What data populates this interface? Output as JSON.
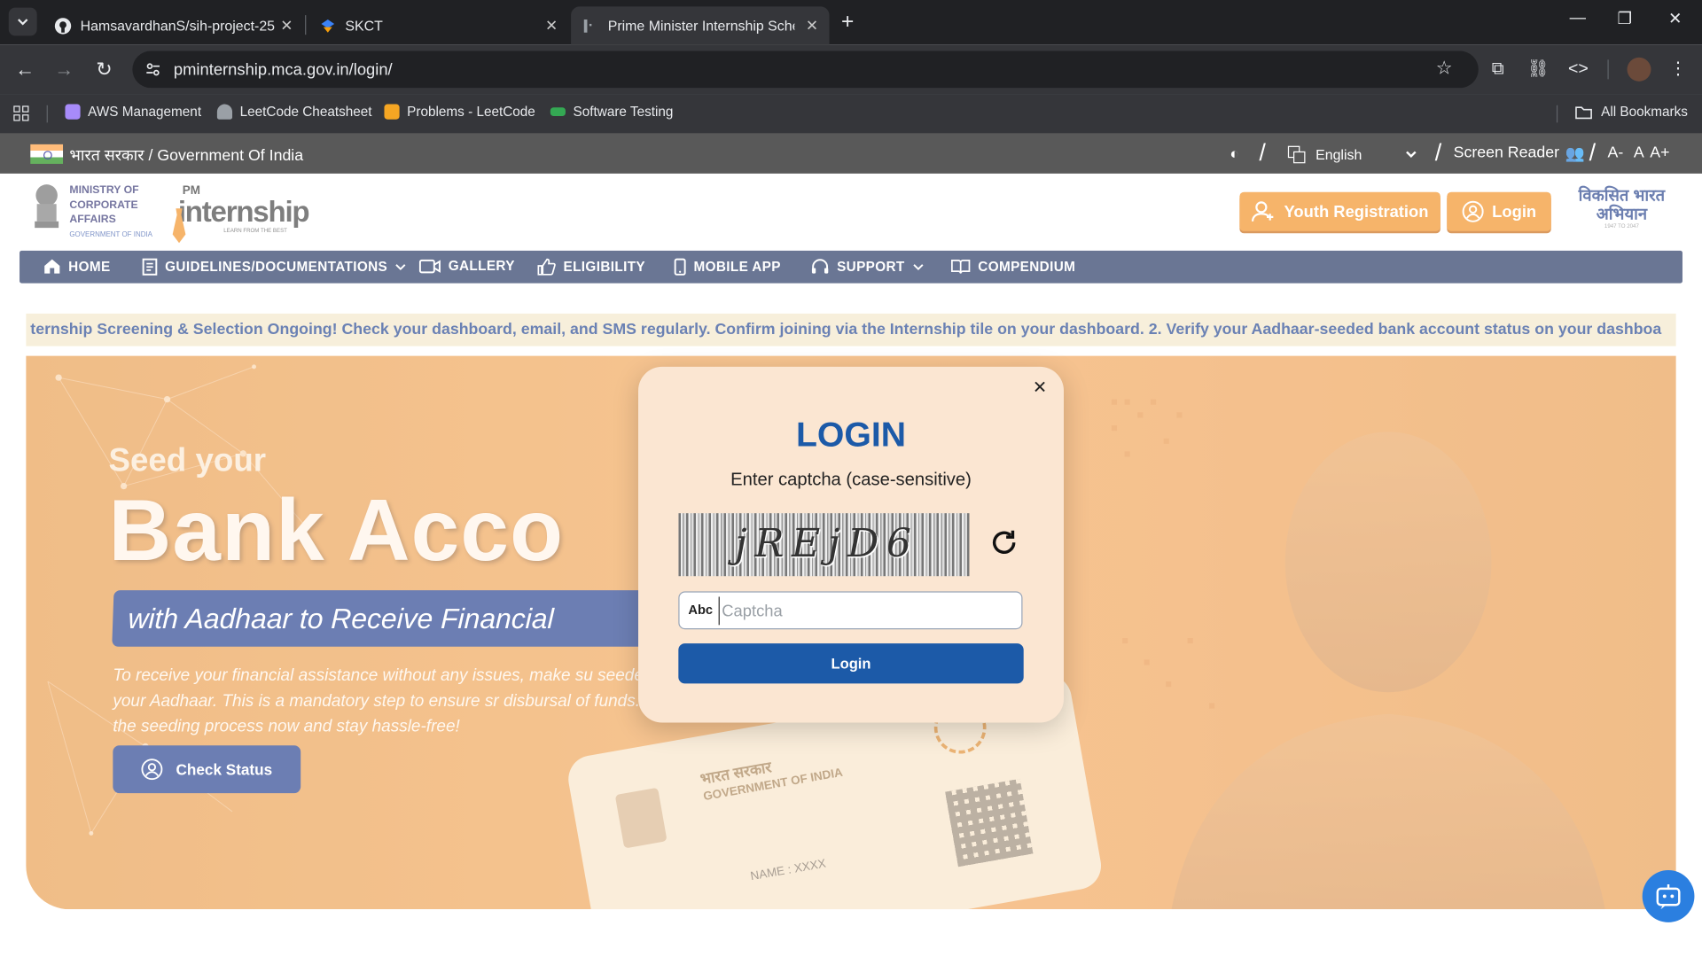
{
  "browser": {
    "tabs": [
      {
        "title": "HamsavardhanS/sih-project-25",
        "active": false
      },
      {
        "title": "SKCT",
        "active": false
      },
      {
        "title": "Prime Minister Internship Schem",
        "active": true
      }
    ],
    "url": "pminternship.mca.gov.in/login/",
    "bookmarks": [
      {
        "label": "AWS Management",
        "color": "#a78bfa"
      },
      {
        "label": "LeetCode Cheatsheet",
        "color": "#9aa0a6"
      },
      {
        "label": "Problems - LeetCode",
        "color": "#f5a623"
      },
      {
        "label": "Software Testing",
        "color": "#34a853"
      }
    ],
    "all_bookmarks": "All Bookmarks"
  },
  "govbar": {
    "title": "भारत सरकार / Government Of India",
    "language": "English",
    "screen_reader": "Screen Reader",
    "font_decrease": "A-",
    "font_normal": "A",
    "font_increase": "A+"
  },
  "header": {
    "mca_line1": "MINISTRY OF",
    "mca_line2": "CORPORATE",
    "mca_line3": "AFFAIRS",
    "mca_sub": "GOVERNMENT OF INDIA",
    "pm_logo_top": "PM",
    "pm_logo_main": "internship",
    "pm_logo_tag": "LEARN FROM THE BEST",
    "youth_registration": "Youth Registration",
    "login": "Login",
    "viksit_line1": "विकसित भारत",
    "viksit_line2": "अभियान",
    "viksit_years": "1947 TO 2047"
  },
  "nav": [
    {
      "label": "HOME",
      "icon": "home-icon"
    },
    {
      "label": "GUIDELINES/DOCUMENTATIONS",
      "icon": "document-icon",
      "dropdown": true
    },
    {
      "label": "GALLERY",
      "icon": "video-icon"
    },
    {
      "label": "ELIGIBILITY",
      "icon": "thumbs-up-icon"
    },
    {
      "label": "MOBILE APP",
      "icon": "mobile-icon"
    },
    {
      "label": "SUPPORT",
      "icon": "headset-icon",
      "dropdown": true
    },
    {
      "label": "COMPENDIUM",
      "icon": "book-icon"
    }
  ],
  "ticker": "ternship Screening & Selection Ongoing! Check your dashboard, email, and SMS regularly. Confirm joining via the Internship tile on your dashboard. 2. Verify your Aadhaar-seeded bank account status on your dashboa",
  "hero": {
    "seed": "Seed your",
    "bank": "Bank Acco",
    "with_bar": "with Aadhaar to Receive Financial",
    "paragraph": "To receive your financial assistance without any issues, make su seeded with your Aadhaar. This is a mandatory step to ensure sr disbursal of funds. Complete the seeding process now and stay hassle-free!",
    "check_status": "Check Status",
    "card_hindi": "भारत सरकार",
    "card_english": "GOVERNMENT OF INDIA",
    "card_name": "NAME : XXXX"
  },
  "modal": {
    "title": "LOGIN",
    "subtitle": "Enter captcha (case-sensitive)",
    "captcha_text": "jREjD6",
    "field_prefix": "Abc",
    "field_placeholder": "Captcha",
    "field_value": "",
    "login_button": "Login"
  },
  "colors": {
    "accent_orange": "#f28c1b",
    "nav_navy": "#1b2d5b",
    "modal_blue": "#1c5aa8",
    "hero_orange": "#f2a555"
  }
}
